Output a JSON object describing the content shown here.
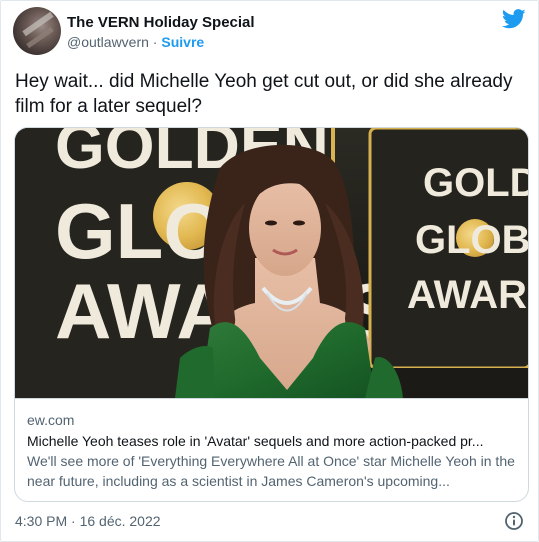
{
  "author": {
    "display_name": "The VERN Holiday Special",
    "handle": "@outlawvern",
    "separator": " · ",
    "follow_label": "Suivre"
  },
  "tweet": {
    "text": "Hey wait... did Michelle Yeoh get cut out, or did she already film for a later sequel?",
    "timestamp": "4:30 PM · 16 déc. 2022"
  },
  "card": {
    "image": {
      "sign_left_lines": [
        "GOLDEN",
        "GLOBE",
        "AWARDS"
      ],
      "sign_right_lines": [
        "GOLDEN",
        "GLOBE",
        "AWARDS"
      ]
    },
    "domain": "ew.com",
    "title": "Michelle Yeoh teases role in 'Avatar' sequels and more action-packed pr...",
    "description": "We'll see more of 'Everything Everywhere All at Once' star Michelle Yeoh in the near future, including as a scientist in James Cameron's upcoming..."
  },
  "icons": {
    "brand": "twitter-bird-icon",
    "info": "info-icon"
  },
  "colors": {
    "accent": "#1d9bf0",
    "text_primary": "#0f1419",
    "text_secondary": "#536471",
    "border": "#cfd9de"
  }
}
